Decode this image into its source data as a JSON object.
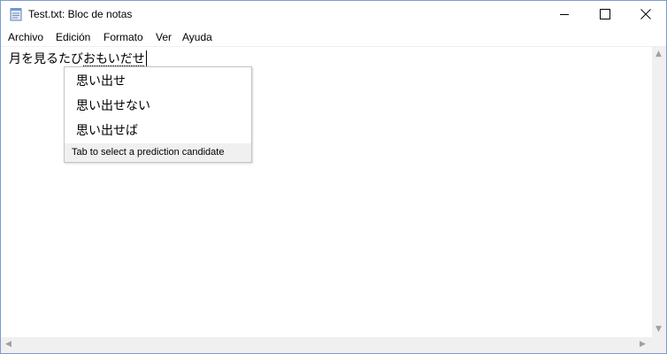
{
  "window": {
    "title": "Test.txt: Bloc de notas"
  },
  "menu": {
    "items": [
      "Archivo",
      "Edición",
      "Formato",
      "Ver",
      "Ayuda"
    ]
  },
  "editor": {
    "committed_text": "月を見るたび",
    "composing_text": "おもいだせ"
  },
  "ime": {
    "candidates": [
      "思い出せ",
      "思い出せない",
      "思い出せば"
    ],
    "hint": "Tab to select a prediction candidate"
  },
  "icons": {
    "app": "notepad-icon",
    "minimize": "minimize-icon",
    "maximize": "maximize-icon",
    "close": "close-icon"
  }
}
